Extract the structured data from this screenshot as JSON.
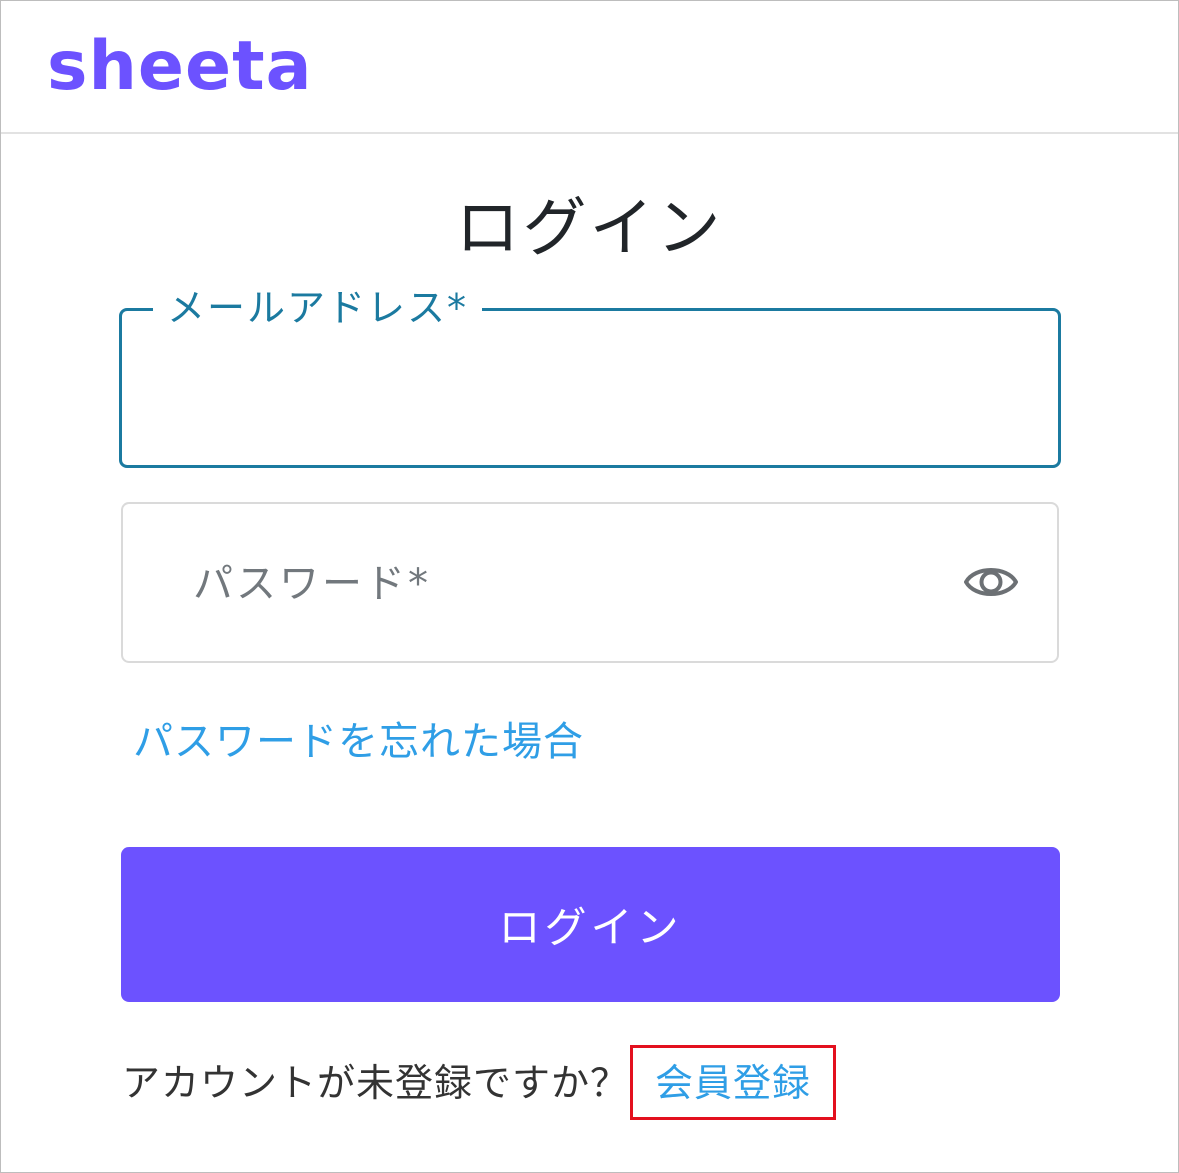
{
  "header": {
    "logo_text": "sheeta"
  },
  "login_form": {
    "title": "ログイン",
    "email": {
      "label": "メールアドレス*",
      "value": ""
    },
    "password": {
      "placeholder": "パスワード*",
      "toggle_icon": "eye-icon"
    },
    "forgot_password_link": "パスワードを忘れた場合",
    "submit_label": "ログイン"
  },
  "signup": {
    "prompt": "アカウントが未登録ですか？",
    "link_label": "会員登録",
    "highlight_color": "#e3101e"
  },
  "colors": {
    "brand": "#6c52ff",
    "focus": "#1b7aa0",
    "link": "#2f9ee6"
  }
}
